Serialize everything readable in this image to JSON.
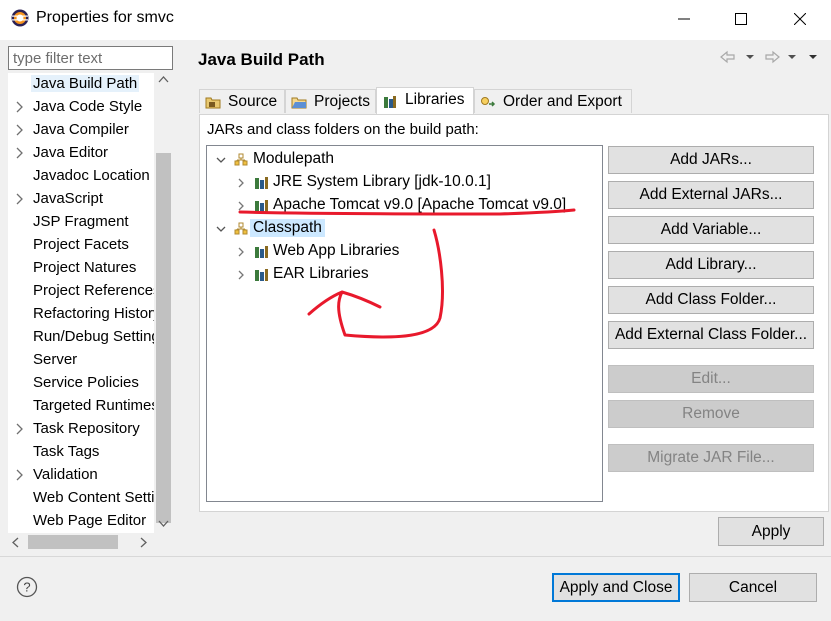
{
  "window": {
    "title": "Properties for smvc",
    "minimize": "—",
    "maximize": "☐",
    "close": "✕"
  },
  "sidebar": {
    "filter_placeholder": "type filter text",
    "items": [
      {
        "label": "Java Build Path",
        "expandable": false,
        "selected": true
      },
      {
        "label": "Java Code Style",
        "expandable": true
      },
      {
        "label": "Java Compiler",
        "expandable": true
      },
      {
        "label": "Java Editor",
        "expandable": true
      },
      {
        "label": "Javadoc Location",
        "expandable": false
      },
      {
        "label": "JavaScript",
        "expandable": true
      },
      {
        "label": "JSP Fragment",
        "expandable": false
      },
      {
        "label": "Project Facets",
        "expandable": false
      },
      {
        "label": "Project Natures",
        "expandable": false
      },
      {
        "label": "Project References",
        "expandable": false
      },
      {
        "label": "Refactoring History",
        "expandable": false
      },
      {
        "label": "Run/Debug Settings",
        "expandable": false
      },
      {
        "label": "Server",
        "expandable": false
      },
      {
        "label": "Service Policies",
        "expandable": false
      },
      {
        "label": "Targeted Runtimes",
        "expandable": false
      },
      {
        "label": "Task Repository",
        "expandable": true
      },
      {
        "label": "Task Tags",
        "expandable": false
      },
      {
        "label": "Validation",
        "expandable": true
      },
      {
        "label": "Web Content Settings",
        "expandable": false
      },
      {
        "label": "Web Page Editor",
        "expandable": false
      }
    ]
  },
  "page": {
    "title": "Java Build Path",
    "tabs": [
      {
        "label": "Source",
        "icon": "source-folder-icon"
      },
      {
        "label": "Projects",
        "icon": "projects-folder-icon"
      },
      {
        "label": "Libraries",
        "icon": "libraries-icon",
        "active": true
      },
      {
        "label": "Order and Export",
        "icon": "order-export-icon"
      }
    ],
    "build_path_label": "JARs and class folders on the build path:",
    "tree": [
      {
        "label": "Modulepath",
        "level": 0,
        "expanded": true,
        "icon": "modulepath-icon"
      },
      {
        "label": "JRE System Library [jdk-10.0.1]",
        "level": 1,
        "expanded": false,
        "icon": "library-icon"
      },
      {
        "label": "Apache Tomcat v9.0 [Apache Tomcat v9.0]",
        "level": 1,
        "expanded": false,
        "icon": "library-icon"
      },
      {
        "label": "Classpath",
        "level": 0,
        "expanded": true,
        "icon": "classpath-icon",
        "selected": true
      },
      {
        "label": "Web App Libraries",
        "level": 1,
        "expanded": false,
        "icon": "library-icon"
      },
      {
        "label": "EAR Libraries",
        "level": 1,
        "expanded": false,
        "icon": "library-icon"
      }
    ],
    "buttons": [
      {
        "label": "Add JARs...",
        "enabled": true
      },
      {
        "label": "Add External JARs...",
        "enabled": true
      },
      {
        "label": "Add Variable...",
        "enabled": true
      },
      {
        "label": "Add Library...",
        "enabled": true
      },
      {
        "label": "Add Class Folder...",
        "enabled": true
      },
      {
        "label": "Add External Class Folder...",
        "enabled": true
      },
      {
        "label": "Edit...",
        "enabled": false
      },
      {
        "label": "Remove",
        "enabled": false
      },
      {
        "label": "Migrate JAR File...",
        "enabled": false
      }
    ],
    "apply_label": "Apply"
  },
  "footer": {
    "help": "?",
    "apply_and_close": "Apply and Close",
    "cancel": "Cancel"
  },
  "colors": {
    "selection": "#cce8ff",
    "annotation_red": "#e8192c",
    "focus_border": "#0078d7"
  }
}
